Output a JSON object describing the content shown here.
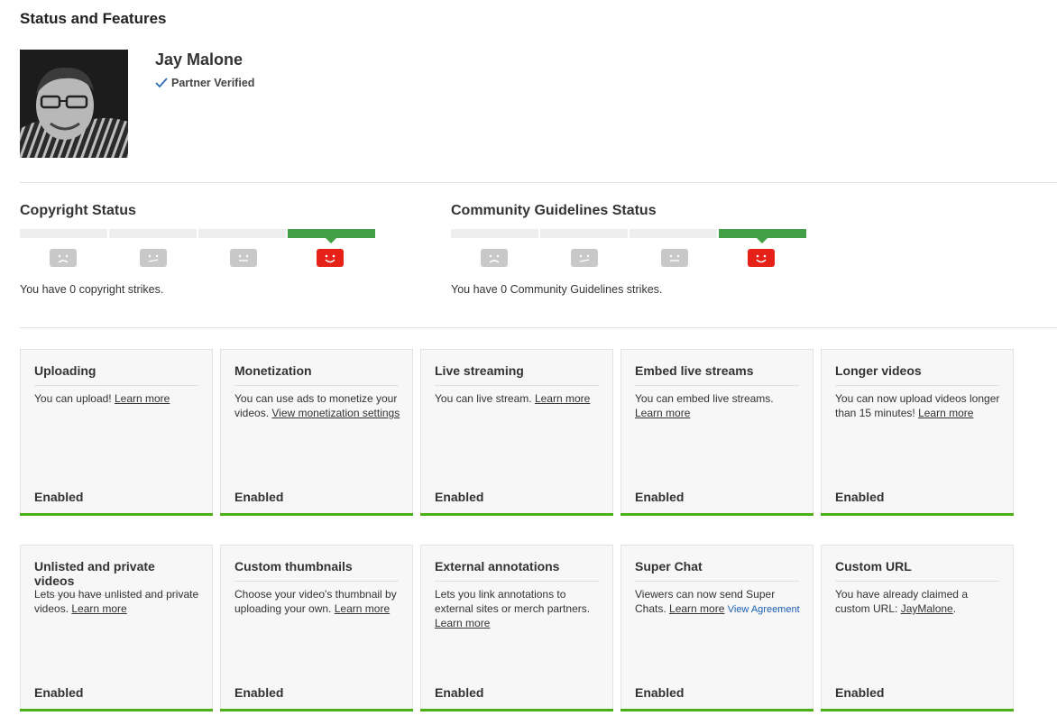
{
  "page": {
    "title": "Status and Features"
  },
  "user": {
    "name": "Jay Malone",
    "verified_label": "Partner Verified"
  },
  "copyright": {
    "title": "Copyright Status",
    "strikes": 0,
    "active_level": 4,
    "text": "You have 0 copyright strikes."
  },
  "community": {
    "title": "Community Guidelines Status",
    "strikes": 0,
    "active_level": 4,
    "text": "You have 0 Community Guidelines strikes."
  },
  "colors": {
    "active_segment": "#43a047",
    "active_face": "#e62117",
    "inactive_face": "#c8c8c8",
    "enabled_bar": "#4caf17"
  },
  "features": [
    {
      "title": "Uploading",
      "text": "You can upload! ",
      "link": "Learn more",
      "status": "Enabled"
    },
    {
      "title": "Monetization",
      "text": "You can use ads to monetize your videos. ",
      "link": "View monetization settings",
      "status": "Enabled"
    },
    {
      "title": "Live streaming",
      "text": "You can live stream. ",
      "link": "Learn more",
      "status": "Enabled"
    },
    {
      "title": "Embed live streams",
      "text": "You can embed live streams. ",
      "link": "Learn more",
      "status": "Enabled"
    },
    {
      "title": "Longer videos",
      "text": "You can now upload videos longer than 15 minutes! ",
      "link": "Learn more",
      "status": "Enabled"
    },
    {
      "title": "Unlisted and private videos",
      "text": "Lets you have unlisted and private videos. ",
      "link": "Learn more",
      "status": "Enabled"
    },
    {
      "title": "Custom thumbnails",
      "text": "Choose your video's thumbnail by uploading your own. ",
      "link": "Learn more",
      "status": "Enabled"
    },
    {
      "title": "External annotations",
      "text": "Lets you link annotations to external sites or merch partners. ",
      "link": "Learn more",
      "status": "Enabled"
    },
    {
      "title": "Super Chat",
      "text": "Viewers can now send Super Chats. ",
      "link": "Learn more",
      "link2": "View Agreement",
      "status": "Enabled"
    },
    {
      "title": "Custom URL",
      "text": "You have already claimed a custom URL: ",
      "link": "JayMalone",
      "suffix": ".",
      "status": "Enabled"
    }
  ]
}
